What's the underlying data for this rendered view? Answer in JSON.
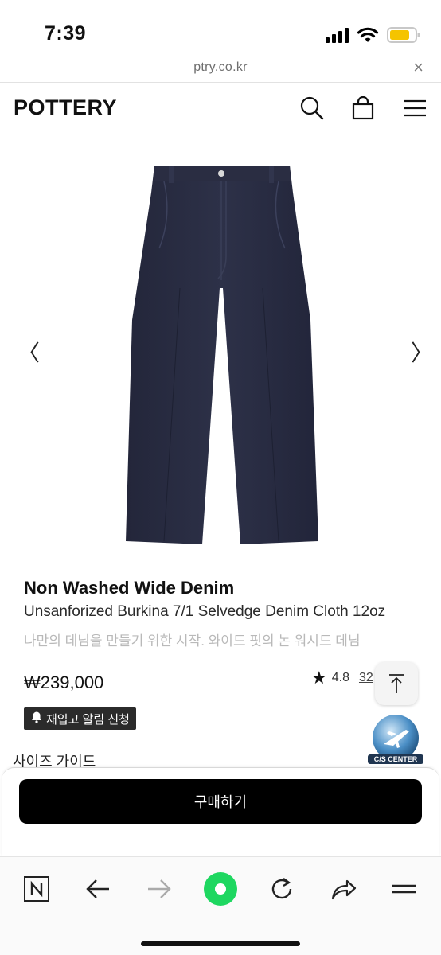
{
  "status_bar": {
    "time": "7:39"
  },
  "browser": {
    "url": "ptry.co.kr",
    "close_glyph": "×"
  },
  "header": {
    "logo": "POTTERY",
    "icons": [
      "search-icon",
      "shopping-bag-icon",
      "hamburger-menu-icon"
    ]
  },
  "gallery": {
    "prev_glyph": "〈",
    "next_glyph": "〉",
    "image": "navy-denim-pants"
  },
  "product": {
    "name": "Non Washed Wide Denim",
    "subtitle": "Unsanforized Burkina 7/1 Selvedge Denim Cloth 12oz",
    "description": "나만의 데님을 만들기 위한 시작. 와이드 핏의 논 워시드 데님",
    "price": "₩239,000",
    "rating": "4.8",
    "review_count": "32",
    "restock_label": "재입고 알림 신청"
  },
  "cs_center": {
    "label": "C/S CENTER"
  },
  "size_guide": {
    "label": "사이즈 가이드"
  },
  "purchase": {
    "buy_label": "구매하기"
  },
  "toolbar": {
    "items": [
      "naver-n-icon",
      "back-arrow-icon",
      "forward-arrow-icon",
      "green-home-icon",
      "reload-icon",
      "share-icon",
      "menu-icon"
    ]
  },
  "colors": {
    "accent_green": "#1ed760",
    "button_black": "#000000",
    "battery_yellow": "#f5c400"
  }
}
